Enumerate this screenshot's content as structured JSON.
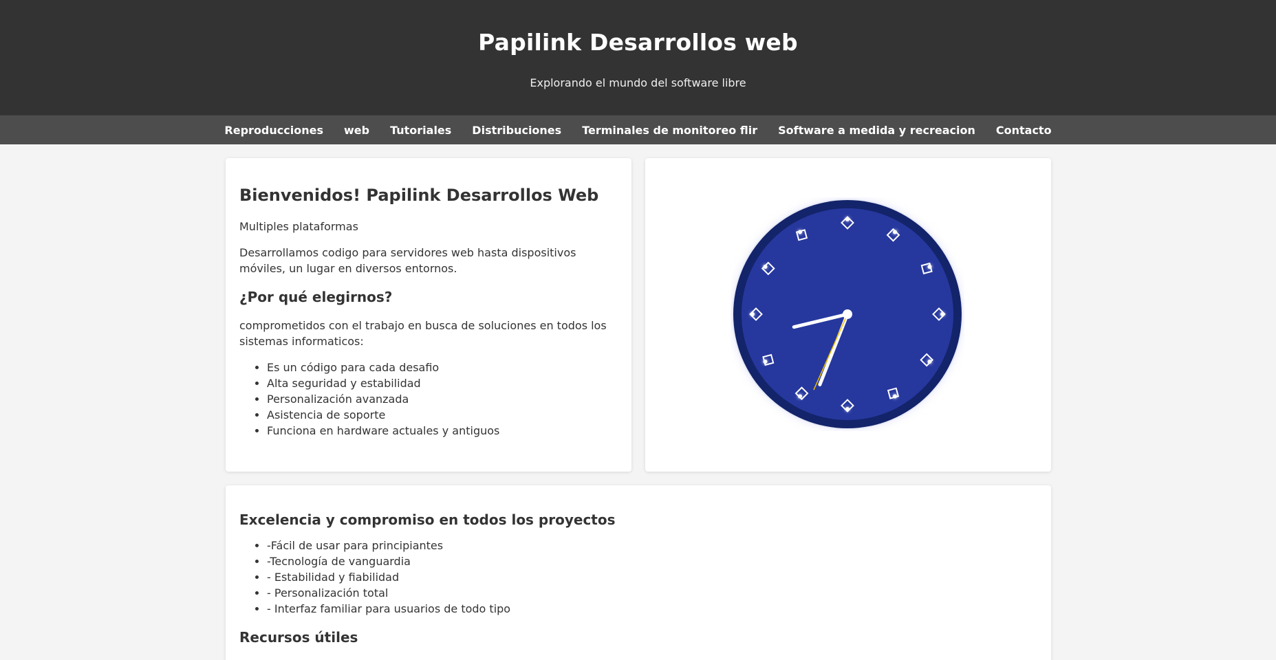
{
  "header": {
    "title": "Papilink Desarrollos web",
    "tagline": "Explorando el mundo del software libre"
  },
  "nav": {
    "items": [
      {
        "label": "Reproducciones"
      },
      {
        "label": "web"
      },
      {
        "label": "Tutoriales"
      },
      {
        "label": "Distribuciones"
      },
      {
        "label": "Terminales de monitoreo flir"
      },
      {
        "label": "Software a medida y recreacion"
      },
      {
        "label": "Contacto"
      }
    ]
  },
  "welcome": {
    "heading": "Bienvenidos! Papilink Desarrollos Web",
    "subtitle": "Multiples plataformas",
    "intro": "Desarrollamos codigo para servidores web hasta dispositivos móviles, un lugar en diversos entornos.",
    "why_heading": "¿Por qué elegirnos?",
    "why_text": "comprometidos con el trabajo en busca de soluciones en todos los sistemas informaticos:",
    "features": [
      "Es un código para cada desafio",
      "Alta seguridad y estabilidad",
      "Personalización avanzada",
      "Asistencia de soporte",
      "Funciona en hardware actuales y antiguos"
    ]
  },
  "clock": {
    "icon": "analog-clock-icon",
    "hour": 8,
    "minute": 33,
    "second": 34,
    "face_color": "#26389e",
    "rim_color": "#13246a",
    "hand_color": "#ffffff",
    "second_hand_color": "#f0c000"
  },
  "excellence": {
    "heading": "Excelencia y compromiso en todos los proyectos",
    "items": [
      "-Fácil de usar para principiantes",
      "-Tecnología de vanguardia",
      "- Estabilidad y fiabilidad",
      "- Personalización total",
      "- Interfaz familiar para usuarios de todo tipo"
    ],
    "resources_heading": "Recursos útiles"
  },
  "colors": {
    "header_bg": "#333333",
    "nav_bg": "#4d4d4d",
    "page_bg": "#f4f4f4"
  }
}
